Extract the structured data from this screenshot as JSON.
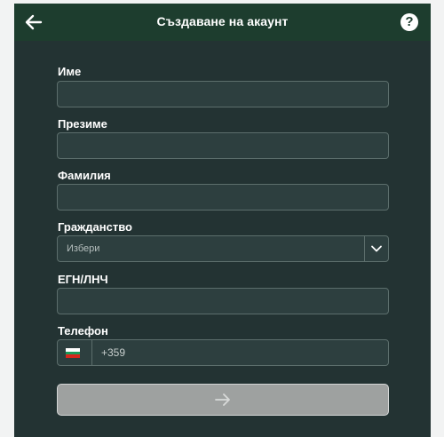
{
  "header": {
    "title": "Създаване на акаунт",
    "back_icon": "arrow-left-icon",
    "help_icon": "question-mark-icon",
    "help_glyph": "?"
  },
  "form": {
    "first_name": {
      "label": "Име",
      "value": ""
    },
    "middle_name": {
      "label": "Презиме",
      "value": ""
    },
    "last_name": {
      "label": "Фамилия",
      "value": ""
    },
    "citizenship": {
      "label": "Гражданство",
      "selected": "Избери",
      "icon": "chevron-down-icon"
    },
    "egn": {
      "label": "ЕГН/ЛНЧ",
      "value": ""
    },
    "phone": {
      "label": "Телефон",
      "prefix": "+359",
      "flag_icon": "bulgaria-flag-icon"
    }
  },
  "submit": {
    "icon": "arrow-right-icon",
    "state": "disabled"
  },
  "colors": {
    "page_bg": "#f2f3f3",
    "panel_bg": "#233333",
    "header_bg": "#1d3d2e",
    "field_bg": "#2d3f3f",
    "field_border": "#5c6e6c",
    "button_bg": "#9ea1a0"
  }
}
